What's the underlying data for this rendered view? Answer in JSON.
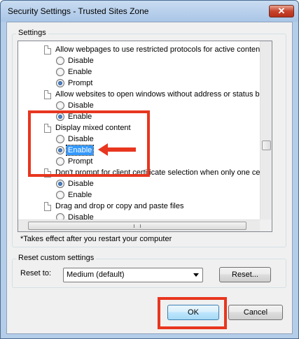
{
  "window": {
    "title": "Security Settings - Trusted Sites Zone",
    "close_glyph": "✕"
  },
  "settings_group": {
    "label": "Settings",
    "note": "*Takes effect after you restart your computer",
    "items": [
      {
        "type": "setting",
        "label": "Allow webpages to use restricted protocols for active conten"
      },
      {
        "type": "option",
        "label": "Disable",
        "checked": false
      },
      {
        "type": "option",
        "label": "Enable",
        "checked": false
      },
      {
        "type": "option",
        "label": "Prompt",
        "checked": true
      },
      {
        "type": "setting",
        "label": "Allow websites to open windows without address or status ba"
      },
      {
        "type": "option",
        "label": "Disable",
        "checked": false
      },
      {
        "type": "option",
        "label": "Enable",
        "checked": true
      },
      {
        "type": "setting",
        "label": "Display mixed content"
      },
      {
        "type": "option",
        "label": "Disable",
        "checked": false
      },
      {
        "type": "option",
        "label": "Enable",
        "checked": true,
        "selected": true
      },
      {
        "type": "option",
        "label": "Prompt",
        "checked": false
      },
      {
        "type": "setting",
        "label": "Don't prompt for client certificate selection when only one ce"
      },
      {
        "type": "option",
        "label": "Disable",
        "checked": true
      },
      {
        "type": "option",
        "label": "Enable",
        "checked": false
      },
      {
        "type": "setting",
        "label": "Drag and drop or copy and paste files"
      },
      {
        "type": "option",
        "label": "Disable",
        "checked": false
      }
    ]
  },
  "reset_group": {
    "label": "Reset custom settings",
    "reset_to_label": "Reset to:",
    "select_value": "Medium (default)",
    "reset_button": "Reset..."
  },
  "buttons": {
    "ok": "OK",
    "cancel": "Cancel"
  },
  "colors": {
    "annotation_red": "#e8361f",
    "selection_blue": "#3399ff"
  }
}
